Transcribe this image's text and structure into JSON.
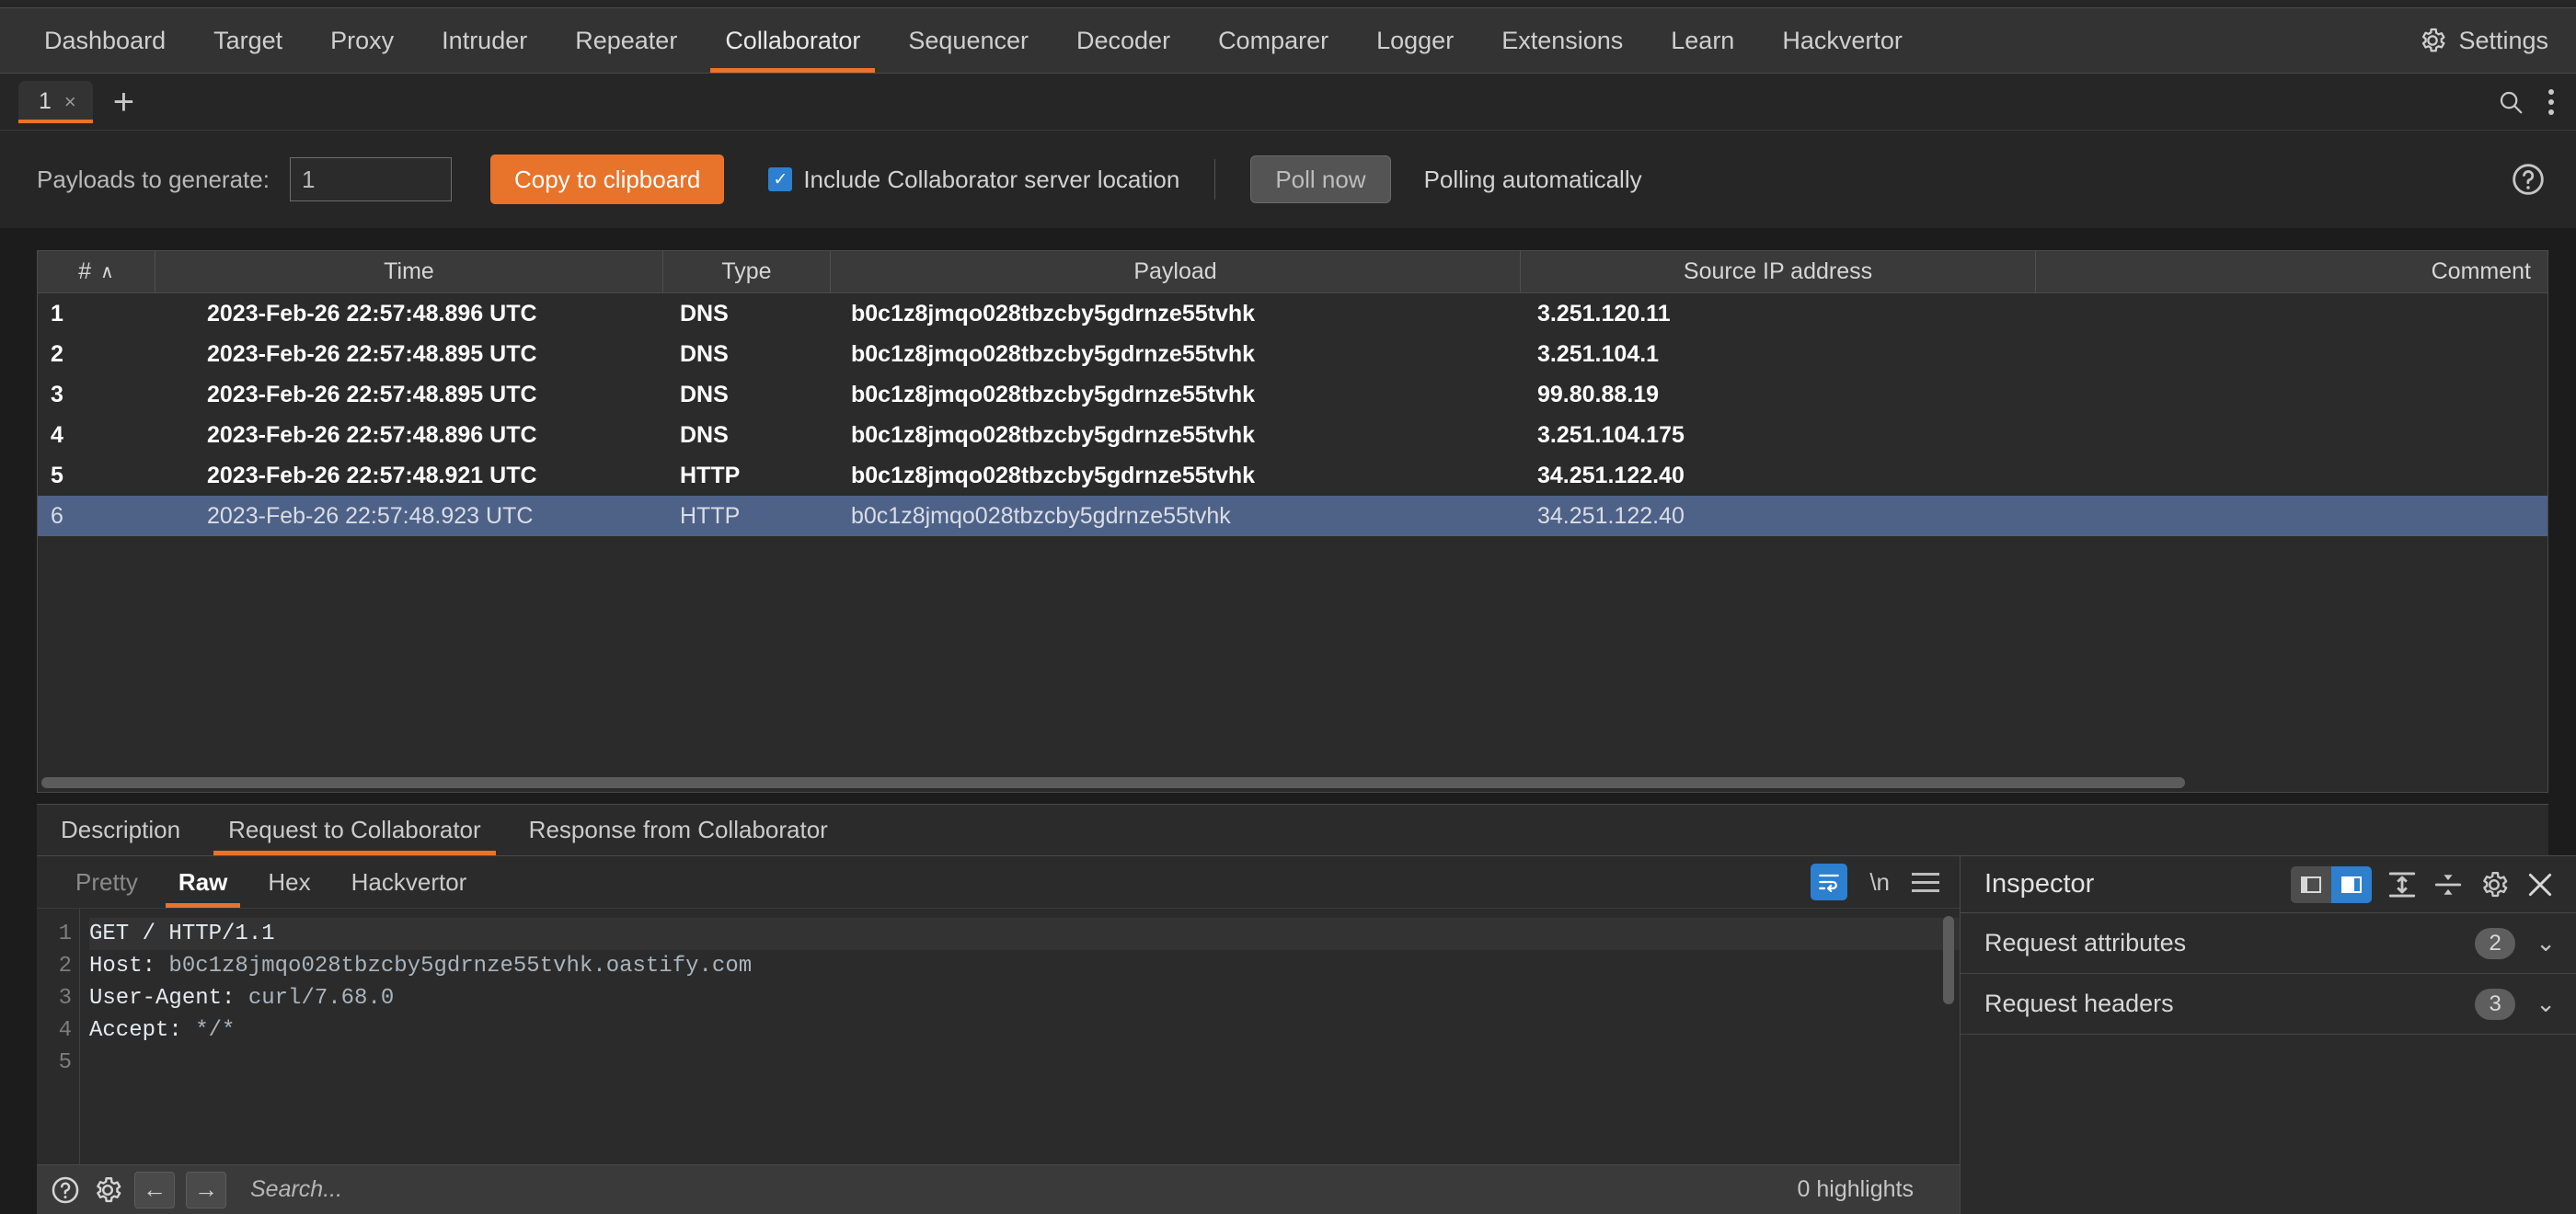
{
  "app": {
    "main_tabs": [
      {
        "label": "Dashboard",
        "active": false
      },
      {
        "label": "Target",
        "active": false
      },
      {
        "label": "Proxy",
        "active": false
      },
      {
        "label": "Intruder",
        "active": false
      },
      {
        "label": "Repeater",
        "active": false
      },
      {
        "label": "Collaborator",
        "active": true
      },
      {
        "label": "Sequencer",
        "active": false
      },
      {
        "label": "Decoder",
        "active": false
      },
      {
        "label": "Comparer",
        "active": false
      },
      {
        "label": "Logger",
        "active": false
      },
      {
        "label": "Extensions",
        "active": false
      },
      {
        "label": "Learn",
        "active": false
      },
      {
        "label": "Hackvertor",
        "active": false
      }
    ],
    "settings_label": "Settings",
    "settings_icon": "gear-icon"
  },
  "sub_tabs": {
    "tabs": [
      {
        "label": "1",
        "close": "×",
        "active": true
      }
    ],
    "add_label": "+",
    "search_icon": "search-icon",
    "menu_icon": "kebab-menu-icon"
  },
  "toolbar": {
    "payloads_label": "Payloads to generate:",
    "payloads_value": "1",
    "payloads_placeholder": "1",
    "copy_button": "Copy to clipboard",
    "include_location_label": "Include Collaborator server location",
    "include_location_checked": true,
    "check_glyph": "✓",
    "poll_now_button": "Poll now",
    "poll_status": "Polling automatically",
    "help_icon": "help-circle-icon"
  },
  "table": {
    "columns": [
      "#",
      "Time",
      "Type",
      "Payload",
      "Source IP address",
      "Comment"
    ],
    "sort_column": "#",
    "sort_caret": "∧",
    "rows": [
      {
        "num": "1",
        "time": "2023-Feb-26 22:57:48.896 UTC",
        "type": "DNS",
        "payload": "b0c1z8jmqo028tbzcby5gdrnze55tvhk",
        "ip": "3.251.120.11",
        "comment": "",
        "selected": false
      },
      {
        "num": "2",
        "time": "2023-Feb-26 22:57:48.895 UTC",
        "type": "DNS",
        "payload": "b0c1z8jmqo028tbzcby5gdrnze55tvhk",
        "ip": "3.251.104.1",
        "comment": "",
        "selected": false
      },
      {
        "num": "3",
        "time": "2023-Feb-26 22:57:48.895 UTC",
        "type": "DNS",
        "payload": "b0c1z8jmqo028tbzcby5gdrnze55tvhk",
        "ip": "99.80.88.19",
        "comment": "",
        "selected": false
      },
      {
        "num": "4",
        "time": "2023-Feb-26 22:57:48.896 UTC",
        "type": "DNS",
        "payload": "b0c1z8jmqo028tbzcby5gdrnze55tvhk",
        "ip": "3.251.104.175",
        "comment": "",
        "selected": false
      },
      {
        "num": "5",
        "time": "2023-Feb-26 22:57:48.921 UTC",
        "type": "HTTP",
        "payload": "b0c1z8jmqo028tbzcby5gdrnze55tvhk",
        "ip": "34.251.122.40",
        "comment": "",
        "selected": false
      },
      {
        "num": "6",
        "time": "2023-Feb-26 22:57:48.923 UTC",
        "type": "HTTP",
        "payload": "b0c1z8jmqo028tbzcby5gdrnze55tvhk",
        "ip": "34.251.122.40",
        "comment": "",
        "selected": true
      }
    ]
  },
  "message_tabs": [
    {
      "label": "Description",
      "active": false
    },
    {
      "label": "Request to Collaborator",
      "active": true
    },
    {
      "label": "Response from Collaborator",
      "active": false
    }
  ],
  "editor": {
    "tabs": [
      {
        "label": "Pretty",
        "state": "dim"
      },
      {
        "label": "Raw",
        "state": "active"
      },
      {
        "label": "Hex",
        "state": "normal"
      },
      {
        "label": "Hackvertor",
        "state": "normal"
      }
    ],
    "wrap_icon": "word-wrap-icon",
    "newline_glyph": "\\n",
    "menu_icon": "hamburger-menu-icon",
    "lines": [
      {
        "n": "1",
        "key": "GET / HTTP/1.1",
        "val": ""
      },
      {
        "n": "2",
        "key": "Host:",
        "val": " b0c1z8jmqo028tbzcby5gdrnze55tvhk.oastify.com"
      },
      {
        "n": "3",
        "key": "User-Agent:",
        "val": " curl/7.68.0"
      },
      {
        "n": "4",
        "key": "Accept:",
        "val": " */*"
      },
      {
        "n": "5",
        "key": "",
        "val": ""
      }
    ]
  },
  "search_bar": {
    "help_icon": "help-circle-icon",
    "settings_icon": "gear-icon",
    "prev_glyph": "←",
    "next_glyph": "→",
    "placeholder": "Search...",
    "value": "",
    "highlights": "0 highlights"
  },
  "inspector": {
    "title": "Inspector",
    "layout_buttons": [
      {
        "name": "layout-left-icon",
        "active": false
      },
      {
        "name": "layout-right-icon",
        "active": true
      }
    ],
    "expand_icon": "expand-vertical-icon",
    "collapse_icon": "collapse-vertical-icon",
    "settings_icon": "gear-icon",
    "close_icon": "close-icon",
    "sections": [
      {
        "label": "Request attributes",
        "count": "2",
        "chevron": "⌄"
      },
      {
        "label": "Request headers",
        "count": "3",
        "chevron": "⌄"
      }
    ]
  },
  "colors": {
    "accent_orange": "#e8732a",
    "accent_blue": "#2d7fd0",
    "selection_blue": "#4e6288",
    "bg_dark": "#262626",
    "bg_panel": "#2b2b2b"
  }
}
